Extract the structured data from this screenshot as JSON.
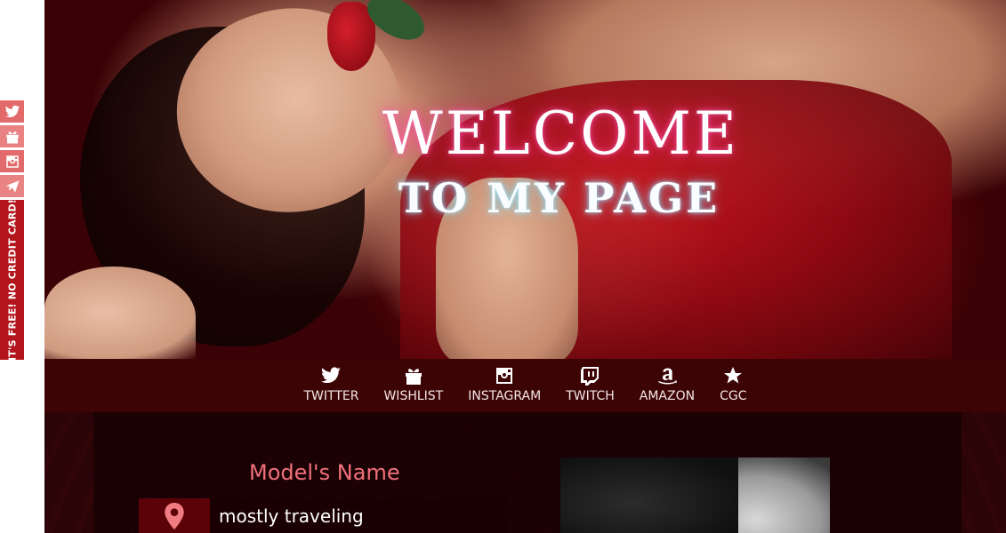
{
  "side_bar": {
    "tab_label": "IT'S FREE! NO CREDIT CARD!",
    "buttons": [
      {
        "icon": "twitter-icon"
      },
      {
        "icon": "gift-icon"
      },
      {
        "icon": "instagram-icon"
      },
      {
        "icon": "paper-plane-icon"
      }
    ]
  },
  "hero": {
    "title_line1": "WELCOME",
    "title_line2": "TO MY PAGE"
  },
  "nav": {
    "items": [
      {
        "label": "TWITTER",
        "icon": "twitter-icon"
      },
      {
        "label": "WISHLIST",
        "icon": "gift-icon"
      },
      {
        "label": "INSTAGRAM",
        "icon": "instagram-icon"
      },
      {
        "label": "TWITCH",
        "icon": "twitch-icon"
      },
      {
        "label": "AMAZON",
        "icon": "amazon-icon"
      },
      {
        "label": "CGC",
        "icon": "star-icon"
      }
    ]
  },
  "profile": {
    "name": "Model's Name",
    "location": "mostly traveling",
    "location_icon": "map-pin-icon"
  },
  "colors": {
    "accent": "#f0707b",
    "nav_bg": "#3d0406",
    "side_tab": "#b3151c"
  }
}
